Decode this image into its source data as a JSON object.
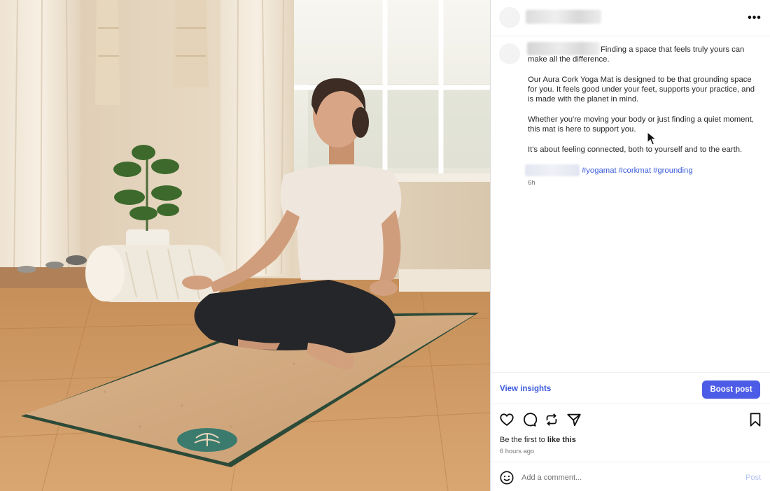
{
  "post": {
    "caption": {
      "first_line": "Finding a space that feels truly yours can make all the difference.",
      "paragraph_2": "Our Aura Cork Yoga Mat is designed to be that grounding space for you. It feels good under your feet, supports your practice, and is made with the planet in mind.",
      "paragraph_3": "Whether you're moving your body or just finding a quiet moment, this mat is here to support you.",
      "paragraph_4": "It's about feeling connected, both to yourself and to the earth."
    },
    "hashtags": [
      "#yogamat",
      "#corkmat",
      "#grounding"
    ],
    "caption_time": "6h",
    "more_label": "•••"
  },
  "insights": {
    "view_label": "View insights",
    "boost_label": "Boost post"
  },
  "actions": {
    "icons": [
      "heart-icon",
      "comment-icon",
      "repost-icon",
      "share-icon",
      "bookmark-icon"
    ]
  },
  "likes": {
    "prefix": "Be the first to ",
    "cta": "like this"
  },
  "timestamp": "6 hours ago",
  "comment": {
    "placeholder": "Add a comment...",
    "post_label": "Post"
  },
  "colors": {
    "accent": "#4c5ce6",
    "link": "#3a5bd9",
    "post_disabled": "#b3c3ee"
  }
}
